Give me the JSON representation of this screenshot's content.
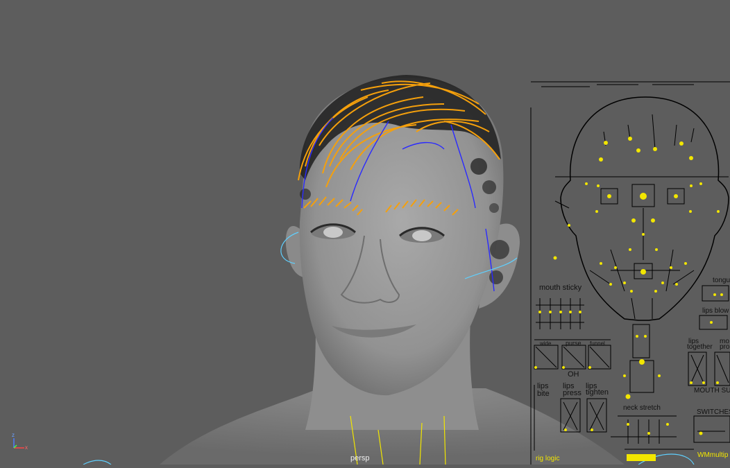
{
  "viewport": {
    "camera_label": "persp",
    "axis": {
      "z": "z",
      "x": "x"
    }
  },
  "panel": {
    "mouth_sticky": "mouth sticky",
    "lips_blow": "lips blow",
    "tongue": "tongu",
    "lips_together": [
      "lips",
      "together"
    ],
    "mo_pro": [
      "mo",
      "pro"
    ],
    "oh_buttons": [
      "wide",
      "purse",
      "funnel"
    ],
    "oh": "OH",
    "lips_bite": [
      "lips",
      "bite"
    ],
    "lips_press": [
      "lips",
      "press"
    ],
    "lips_tighten": [
      "lips",
      "tighten"
    ],
    "mouth_suck": "MOUTH SUC",
    "neck_stretch": "neck stretch",
    "switches": "SWITCHES",
    "rig_logic": "rig logic",
    "wm_multiply": "WMmultip"
  },
  "colors": {
    "background": "#5d5d5d",
    "skin": "#9a9a9a",
    "hair_curve": "#f5a00c",
    "nurbs_blue": "#2a2aff",
    "cyan_curve": "#5fd0ff",
    "control_yellow": "#f2e600"
  }
}
